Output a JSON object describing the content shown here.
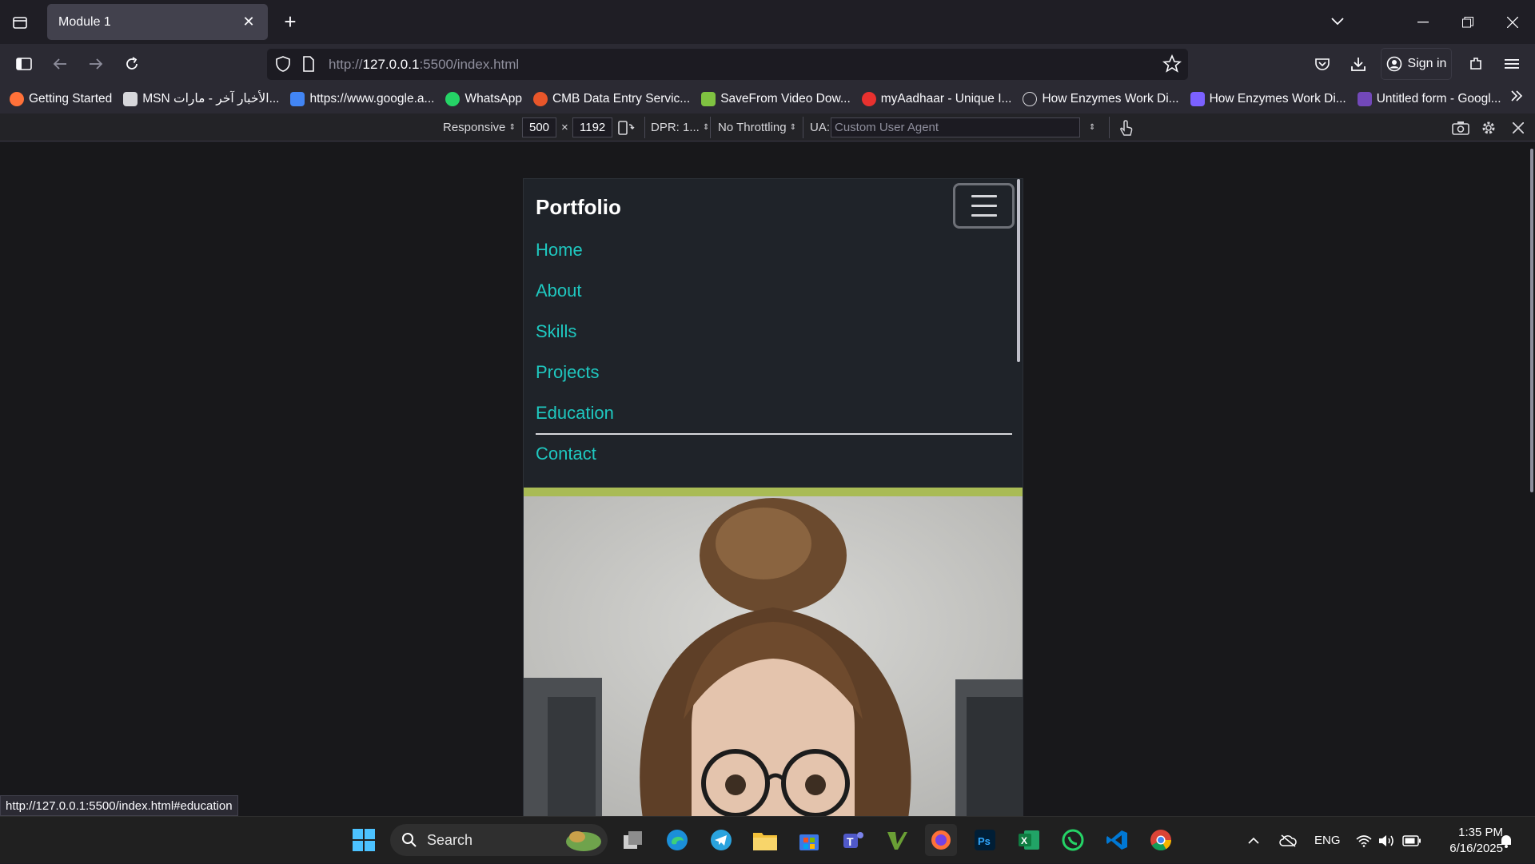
{
  "browser": {
    "tab": {
      "title": "Module 1"
    },
    "url": {
      "prefix": "http://",
      "host": "127.0.0.1",
      "rest": ":5500/index.html"
    },
    "sign_in": "Sign in",
    "bookmarks": [
      {
        "label": "Getting Started",
        "color": "#ff7139"
      },
      {
        "label": "MSN الأخبار آخر - مارات...",
        "color": "#d7d7db"
      },
      {
        "label": "https://www.google.a...",
        "color": "#4285f4"
      },
      {
        "label": "WhatsApp",
        "color": "#25d366"
      },
      {
        "label": "CMB Data Entry Servic...",
        "color": "#e8562a"
      },
      {
        "label": "SaveFrom Video Dow...",
        "color": "#7fc241"
      },
      {
        "label": "myAadhaar - Unique I...",
        "color": "#e8312f"
      },
      {
        "label": "How Enzymes Work Di...",
        "color": "#d7d7db"
      },
      {
        "label": "How Enzymes Work Di...",
        "color": "#7b61ff"
      },
      {
        "label": "Untitled form - Googl...",
        "color": "#7248b9"
      }
    ]
  },
  "rdm": {
    "device": "Responsive",
    "width": "500",
    "times": "×",
    "height": "1192",
    "dpr": "DPR: 1...",
    "throttling": "No Throttling",
    "ua_label": "UA:",
    "ua_placeholder": "Custom User Agent"
  },
  "site": {
    "brand": "Portfolio",
    "menu": [
      "Home",
      "About",
      "Skills",
      "Projects",
      "Education",
      "Contact"
    ]
  },
  "status_url": "http://127.0.0.1:5500/index.html#education",
  "taskbar": {
    "search": "Search",
    "lang": "ENG",
    "time": "1:35 PM",
    "date": "6/16/2025"
  },
  "colors": {
    "menu_link": "#1fc8c0",
    "page_bg": "#1f2329",
    "hero_band": "#a9bb55"
  }
}
